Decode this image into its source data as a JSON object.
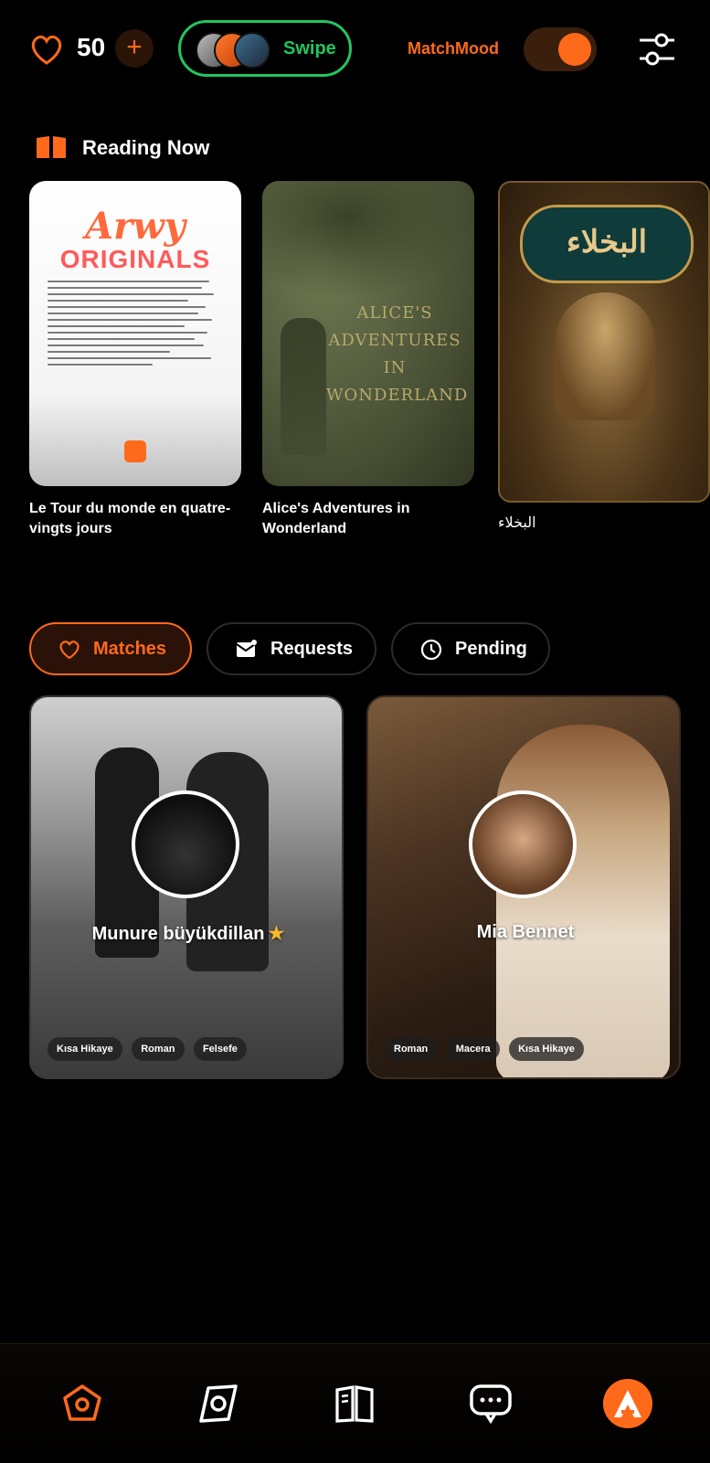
{
  "header": {
    "likes_count": "50",
    "swipe_label": "Swipe",
    "matchmood_label": "MatchMood",
    "matchmood_on": true,
    "accent": "#ff6a1a",
    "swipe_color": "#22c55e"
  },
  "reading_now": {
    "title": "Reading Now",
    "books": [
      {
        "title": "Le Tour du monde en quatre-vingts jours",
        "cover_text_1": "Arwy",
        "cover_text_2": "ORIGINALS"
      },
      {
        "title": "Alice's Adventures in Wonderland",
        "cover_text": "ALICE'S ADVENTURES IN WONDERLAND"
      },
      {
        "title": "البخلاء",
        "cover_text": "البخلاء"
      }
    ]
  },
  "tabs": [
    {
      "label": "Matches",
      "icon": "heart-icon",
      "active": true
    },
    {
      "label": "Requests",
      "icon": "mail-icon",
      "active": false
    },
    {
      "label": "Pending",
      "icon": "clock-icon",
      "active": false
    }
  ],
  "matches": [
    {
      "name": "Munure büyükdillan",
      "badge": "★",
      "tags": [
        "Kısa Hikaye",
        "Roman",
        "Felsefe"
      ]
    },
    {
      "name": "Mia Bennet",
      "badge": "",
      "tags": [
        "Roman",
        "Macera",
        "Kısa Hikaye"
      ]
    }
  ],
  "nav": [
    "home-icon",
    "explore-icon",
    "library-icon",
    "chat-icon",
    "profile-logo-icon"
  ]
}
